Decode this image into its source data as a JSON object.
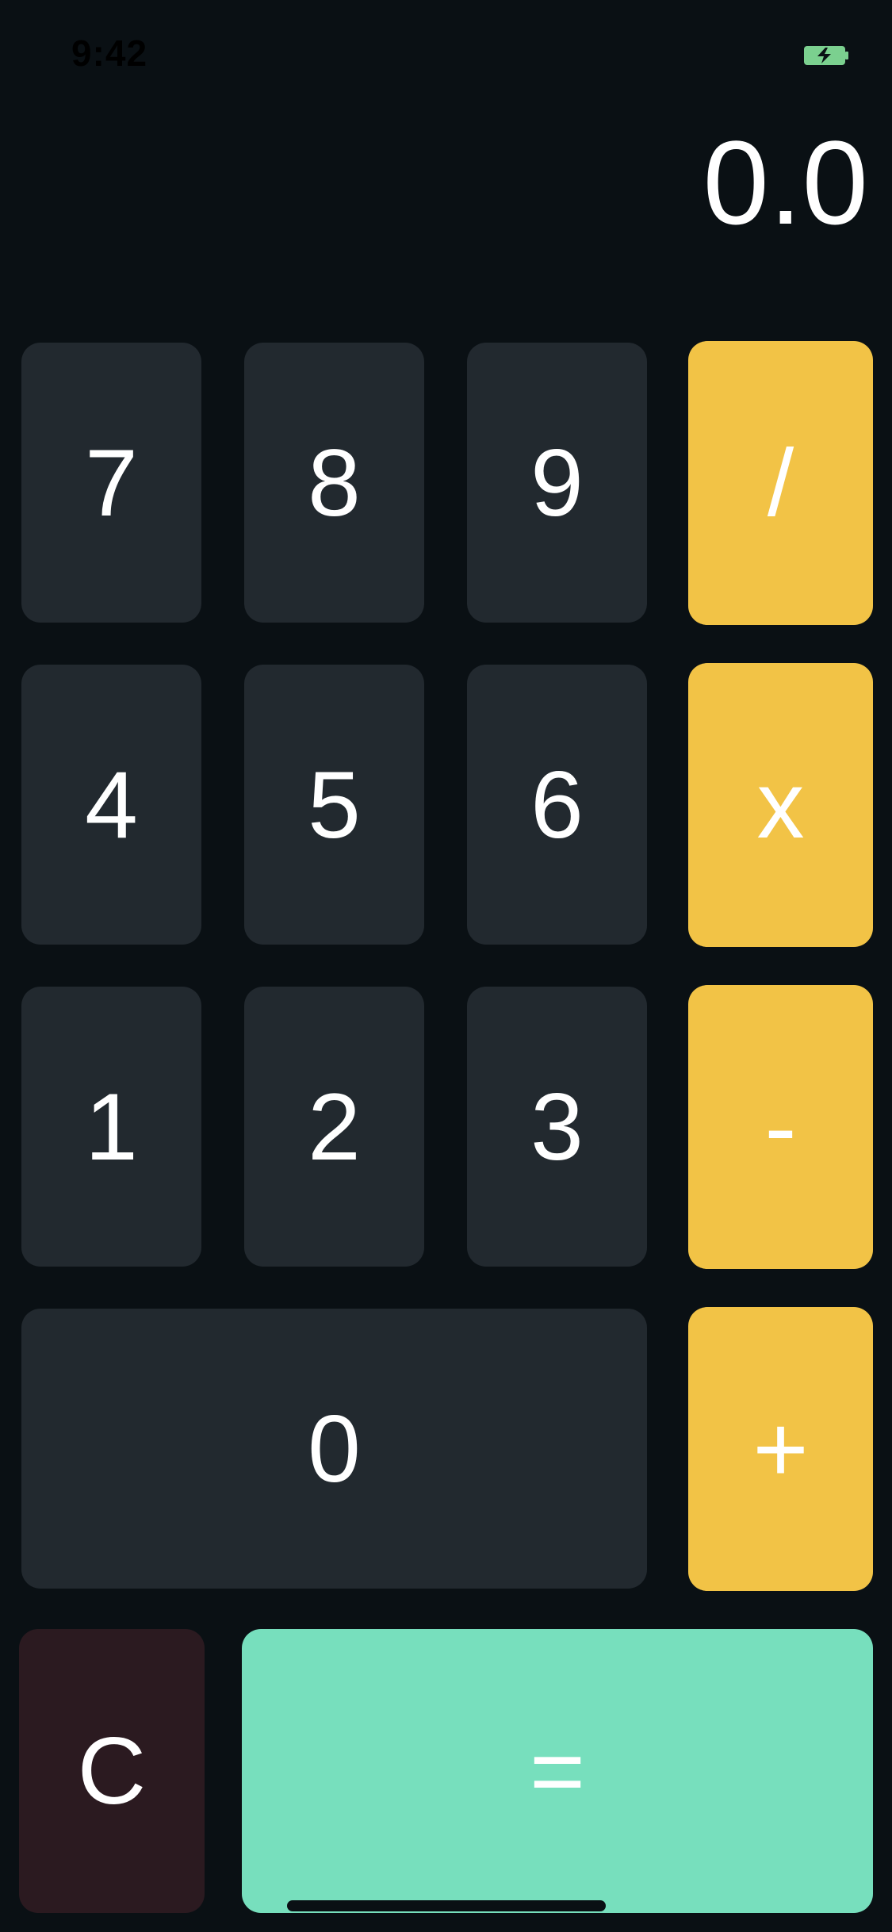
{
  "status_bar": {
    "time": "9:42",
    "battery_icon": "battery-charging-icon",
    "battery_color": "#7bd08f"
  },
  "display": {
    "value": "0.0"
  },
  "keys": {
    "seven": "7",
    "eight": "8",
    "nine": "9",
    "divide": "/",
    "four": "4",
    "five": "5",
    "six": "6",
    "multiply": "x",
    "one": "1",
    "two": "2",
    "three": "3",
    "subtract": "-",
    "zero": "0",
    "add": "+",
    "clear": "C",
    "equals": "="
  },
  "colors": {
    "background": "#0a1014",
    "number_key": "#22292f",
    "operator_key": "#f2c346",
    "clear_key": "#2b1a20",
    "equals_key": "#77dfbd"
  }
}
